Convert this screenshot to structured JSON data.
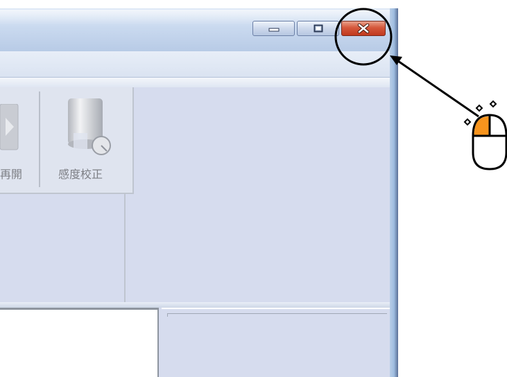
{
  "window": {
    "caption_buttons": {
      "minimize": "minimize",
      "maximize": "maximize",
      "close": "close"
    },
    "toolbar": {
      "items": [
        {
          "label": "再開",
          "icon": "play-icon"
        },
        {
          "label": "感度校正",
          "icon": "calibration-icon"
        }
      ]
    }
  },
  "annotation": {
    "highlighted_target": "close-button",
    "pointer_icon": "mouse-left-click-icon",
    "accent_color": "#f7941d"
  }
}
